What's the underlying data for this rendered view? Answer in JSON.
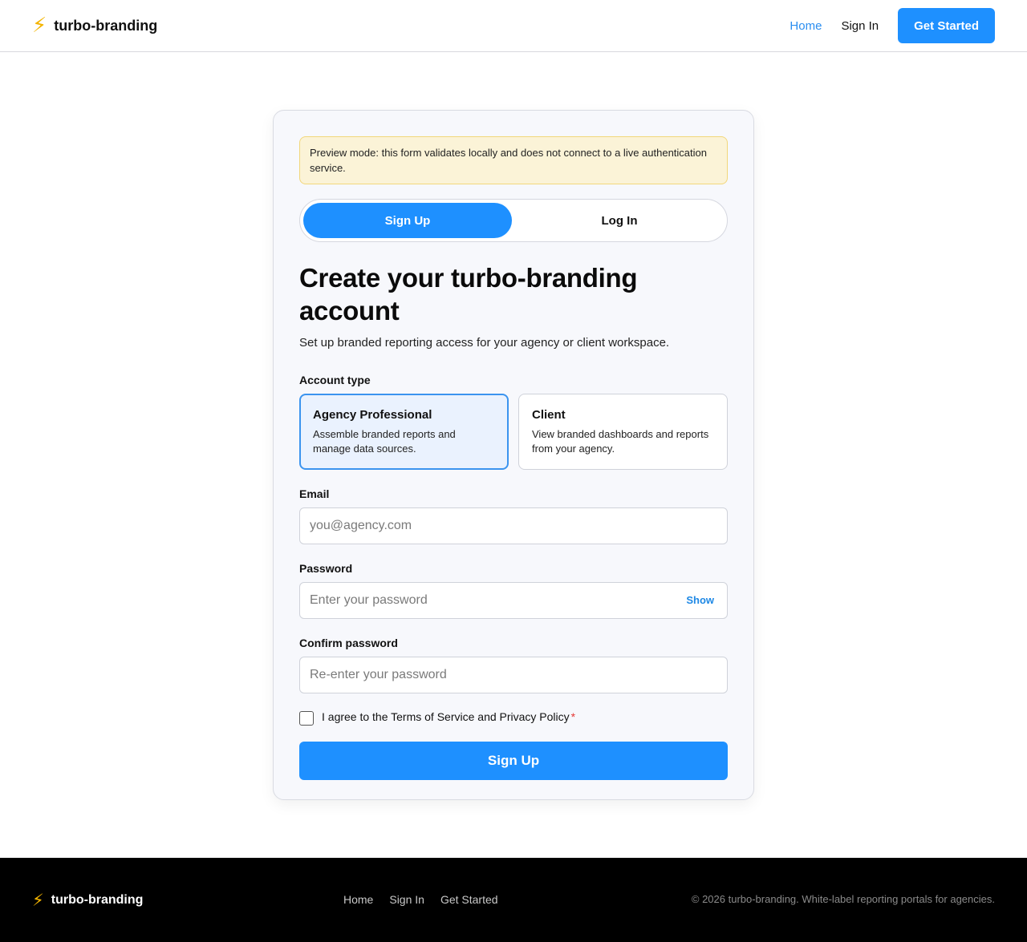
{
  "header": {
    "brand_icon": "lightning-bolt-icon",
    "brand_name": "turbo-branding",
    "nav": {
      "home": "Home",
      "sign_in": "Sign In",
      "get_started": "Get Started"
    },
    "accent_color": "#1e90ff"
  },
  "notice": {
    "text": "Preview mode: this form validates locally and does not connect to a live authentication service."
  },
  "toggle": {
    "signup": "Sign Up",
    "login": "Log In",
    "selected": "Sign Up"
  },
  "form": {
    "title": "Create your turbo-branding account",
    "subtitle": "Set up branded reporting access for your agency or client workspace.",
    "account_type_label": "Account type",
    "account_types": [
      {
        "title": "Agency Professional",
        "desc": "Assemble branded reports and manage data sources.",
        "selected": true
      },
      {
        "title": "Client",
        "desc": "View branded dashboards and reports from your agency.",
        "selected": false
      }
    ],
    "email": {
      "label": "Email",
      "value": "",
      "placeholder": "you@agency.com"
    },
    "password": {
      "label": "Password",
      "value": "",
      "placeholder": "Enter your password",
      "toggle_label": "Show"
    },
    "confirm": {
      "label": "Confirm password",
      "value": "",
      "placeholder": "Re-enter your password"
    },
    "agree": {
      "text": "I agree to the Terms of Service and Privacy Policy",
      "required_mark": "*",
      "checked": false
    },
    "submit_label": "Sign Up"
  },
  "footer": {
    "brand_name": "turbo-branding",
    "links": [
      "Home",
      "Sign In",
      "Get Started"
    ],
    "copyright": "© 2026 turbo-branding. White-label reporting portals for agencies."
  }
}
